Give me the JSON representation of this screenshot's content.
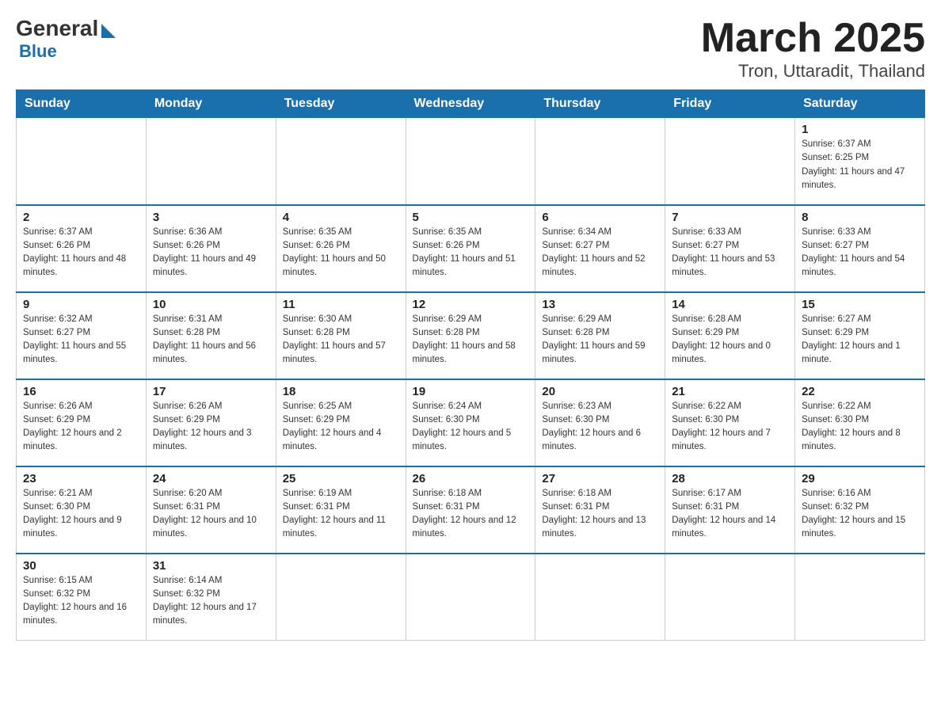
{
  "header": {
    "logo_general": "General",
    "logo_blue": "Blue",
    "title": "March 2025",
    "location": "Tron, Uttaradit, Thailand"
  },
  "weekdays": [
    "Sunday",
    "Monday",
    "Tuesday",
    "Wednesday",
    "Thursday",
    "Friday",
    "Saturday"
  ],
  "weeks": [
    [
      null,
      null,
      null,
      null,
      null,
      null,
      {
        "day": "1",
        "sunrise": "Sunrise: 6:37 AM",
        "sunset": "Sunset: 6:25 PM",
        "daylight": "Daylight: 11 hours and 47 minutes."
      }
    ],
    [
      {
        "day": "2",
        "sunrise": "Sunrise: 6:37 AM",
        "sunset": "Sunset: 6:26 PM",
        "daylight": "Daylight: 11 hours and 48 minutes."
      },
      {
        "day": "3",
        "sunrise": "Sunrise: 6:36 AM",
        "sunset": "Sunset: 6:26 PM",
        "daylight": "Daylight: 11 hours and 49 minutes."
      },
      {
        "day": "4",
        "sunrise": "Sunrise: 6:35 AM",
        "sunset": "Sunset: 6:26 PM",
        "daylight": "Daylight: 11 hours and 50 minutes."
      },
      {
        "day": "5",
        "sunrise": "Sunrise: 6:35 AM",
        "sunset": "Sunset: 6:26 PM",
        "daylight": "Daylight: 11 hours and 51 minutes."
      },
      {
        "day": "6",
        "sunrise": "Sunrise: 6:34 AM",
        "sunset": "Sunset: 6:27 PM",
        "daylight": "Daylight: 11 hours and 52 minutes."
      },
      {
        "day": "7",
        "sunrise": "Sunrise: 6:33 AM",
        "sunset": "Sunset: 6:27 PM",
        "daylight": "Daylight: 11 hours and 53 minutes."
      },
      {
        "day": "8",
        "sunrise": "Sunrise: 6:33 AM",
        "sunset": "Sunset: 6:27 PM",
        "daylight": "Daylight: 11 hours and 54 minutes."
      }
    ],
    [
      {
        "day": "9",
        "sunrise": "Sunrise: 6:32 AM",
        "sunset": "Sunset: 6:27 PM",
        "daylight": "Daylight: 11 hours and 55 minutes."
      },
      {
        "day": "10",
        "sunrise": "Sunrise: 6:31 AM",
        "sunset": "Sunset: 6:28 PM",
        "daylight": "Daylight: 11 hours and 56 minutes."
      },
      {
        "day": "11",
        "sunrise": "Sunrise: 6:30 AM",
        "sunset": "Sunset: 6:28 PM",
        "daylight": "Daylight: 11 hours and 57 minutes."
      },
      {
        "day": "12",
        "sunrise": "Sunrise: 6:29 AM",
        "sunset": "Sunset: 6:28 PM",
        "daylight": "Daylight: 11 hours and 58 minutes."
      },
      {
        "day": "13",
        "sunrise": "Sunrise: 6:29 AM",
        "sunset": "Sunset: 6:28 PM",
        "daylight": "Daylight: 11 hours and 59 minutes."
      },
      {
        "day": "14",
        "sunrise": "Sunrise: 6:28 AM",
        "sunset": "Sunset: 6:29 PM",
        "daylight": "Daylight: 12 hours and 0 minutes."
      },
      {
        "day": "15",
        "sunrise": "Sunrise: 6:27 AM",
        "sunset": "Sunset: 6:29 PM",
        "daylight": "Daylight: 12 hours and 1 minute."
      }
    ],
    [
      {
        "day": "16",
        "sunrise": "Sunrise: 6:26 AM",
        "sunset": "Sunset: 6:29 PM",
        "daylight": "Daylight: 12 hours and 2 minutes."
      },
      {
        "day": "17",
        "sunrise": "Sunrise: 6:26 AM",
        "sunset": "Sunset: 6:29 PM",
        "daylight": "Daylight: 12 hours and 3 minutes."
      },
      {
        "day": "18",
        "sunrise": "Sunrise: 6:25 AM",
        "sunset": "Sunset: 6:29 PM",
        "daylight": "Daylight: 12 hours and 4 minutes."
      },
      {
        "day": "19",
        "sunrise": "Sunrise: 6:24 AM",
        "sunset": "Sunset: 6:30 PM",
        "daylight": "Daylight: 12 hours and 5 minutes."
      },
      {
        "day": "20",
        "sunrise": "Sunrise: 6:23 AM",
        "sunset": "Sunset: 6:30 PM",
        "daylight": "Daylight: 12 hours and 6 minutes."
      },
      {
        "day": "21",
        "sunrise": "Sunrise: 6:22 AM",
        "sunset": "Sunset: 6:30 PM",
        "daylight": "Daylight: 12 hours and 7 minutes."
      },
      {
        "day": "22",
        "sunrise": "Sunrise: 6:22 AM",
        "sunset": "Sunset: 6:30 PM",
        "daylight": "Daylight: 12 hours and 8 minutes."
      }
    ],
    [
      {
        "day": "23",
        "sunrise": "Sunrise: 6:21 AM",
        "sunset": "Sunset: 6:30 PM",
        "daylight": "Daylight: 12 hours and 9 minutes."
      },
      {
        "day": "24",
        "sunrise": "Sunrise: 6:20 AM",
        "sunset": "Sunset: 6:31 PM",
        "daylight": "Daylight: 12 hours and 10 minutes."
      },
      {
        "day": "25",
        "sunrise": "Sunrise: 6:19 AM",
        "sunset": "Sunset: 6:31 PM",
        "daylight": "Daylight: 12 hours and 11 minutes."
      },
      {
        "day": "26",
        "sunrise": "Sunrise: 6:18 AM",
        "sunset": "Sunset: 6:31 PM",
        "daylight": "Daylight: 12 hours and 12 minutes."
      },
      {
        "day": "27",
        "sunrise": "Sunrise: 6:18 AM",
        "sunset": "Sunset: 6:31 PM",
        "daylight": "Daylight: 12 hours and 13 minutes."
      },
      {
        "day": "28",
        "sunrise": "Sunrise: 6:17 AM",
        "sunset": "Sunset: 6:31 PM",
        "daylight": "Daylight: 12 hours and 14 minutes."
      },
      {
        "day": "29",
        "sunrise": "Sunrise: 6:16 AM",
        "sunset": "Sunset: 6:32 PM",
        "daylight": "Daylight: 12 hours and 15 minutes."
      }
    ],
    [
      {
        "day": "30",
        "sunrise": "Sunrise: 6:15 AM",
        "sunset": "Sunset: 6:32 PM",
        "daylight": "Daylight: 12 hours and 16 minutes."
      },
      {
        "day": "31",
        "sunrise": "Sunrise: 6:14 AM",
        "sunset": "Sunset: 6:32 PM",
        "daylight": "Daylight: 12 hours and 17 minutes."
      },
      null,
      null,
      null,
      null,
      null
    ]
  ]
}
